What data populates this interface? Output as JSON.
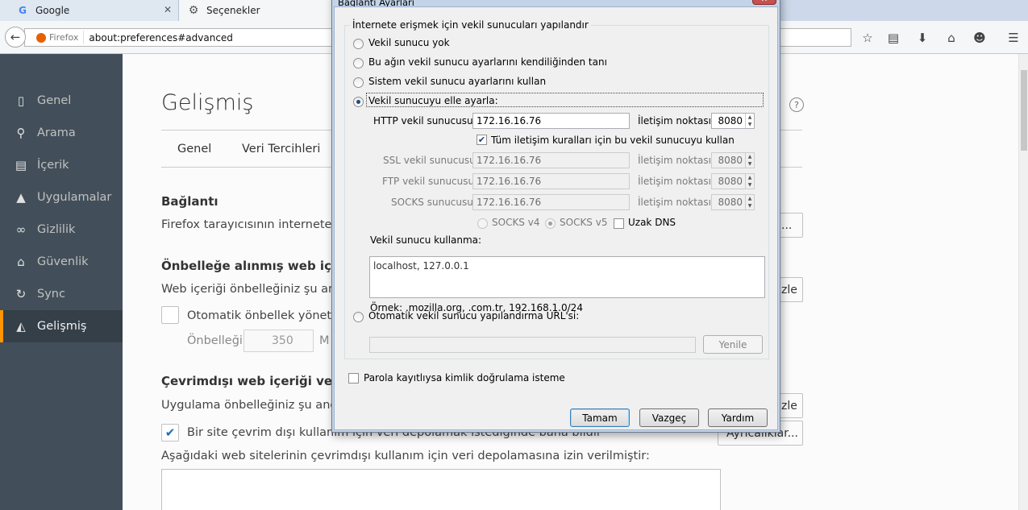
{
  "browser": {
    "tabs": [
      {
        "label": "Google",
        "icon": "google-icon",
        "active": false
      },
      {
        "label": "Seçenekler",
        "icon": "gear-icon",
        "active": true
      }
    ],
    "identity_label": "Firefox",
    "url": "about:preferences#advanced"
  },
  "sidebar": {
    "items": [
      {
        "label": "Genel",
        "icon": "general-icon",
        "selected": false
      },
      {
        "label": "Arama",
        "icon": "search-icon",
        "selected": false
      },
      {
        "label": "İçerik",
        "icon": "content-icon",
        "selected": false
      },
      {
        "label": "Uygulamalar",
        "icon": "rocket-icon",
        "selected": false
      },
      {
        "label": "Gizlilik",
        "icon": "mask-icon",
        "selected": false
      },
      {
        "label": "Güvenlik",
        "icon": "lock-icon",
        "selected": false
      },
      {
        "label": "Sync",
        "icon": "sync-icon",
        "selected": false
      },
      {
        "label": "Gelişmiş",
        "icon": "wizard-hat-icon",
        "selected": true
      }
    ]
  },
  "main": {
    "title": "Gelişmiş",
    "subtabs": [
      "Genel",
      "Veri Tercihleri"
    ],
    "connection": {
      "heading": "Bağlantı",
      "desc": "Firefox tarayıcısının internete na",
      "button_label": "..."
    },
    "cache": {
      "heading": "Önbelleğe alınmış web içeri",
      "desc": "Web içeriği önbelleğiniz şu anda",
      "clear_label": "zle",
      "auto_label": "Otomatik önbellek yönetim",
      "limit_label": "Önbelleği",
      "limit_value": "350",
      "unit": "M"
    },
    "offline": {
      "heading": "Çevrimdışı web içeriği ve ku",
      "desc": "Uygulama önbelleğiniz şu anda",
      "clear_label": "zle",
      "notify_label": "Bir site çevrim dışı kullanım için veri depolamak istediğinde bana bildir",
      "notify_checked": true,
      "exceptions_label": "Ayrıcalıklar...",
      "allowed_label": "Aşağıdaki web sitelerinin çevrimdışı kullanım için veri depolamasına izin verilmiştir:"
    }
  },
  "dialog": {
    "title": "Bağlantı Ayarları",
    "group_label": "İnternete erişmek için vekil sunucuları yapılandır",
    "options": {
      "no_proxy": "Vekil sunucu yok",
      "auto_detect": "Bu ağın vekil sunucu ayarlarını kendiliğinden tanı",
      "system": "Sistem vekil sunucu ayarlarını kullan",
      "manual": "Vekil sunucuyu elle ayarla:",
      "pac": "Otomatik vekil sunucu yapılandırma URL'si:"
    },
    "selected_option": "manual",
    "http_label": "HTTP vekil sunucusu:",
    "http_value": "172.16.16.76",
    "http_port_label": "İletişim noktası:",
    "http_port": "8080",
    "share_label": "Tüm iletişim kuralları için bu vekil sunucuyu kullan",
    "share_checked": true,
    "ssl_label": "SSL vekil sunucusu:",
    "ssl_value": "172.16.16.76",
    "ssl_port_label": "İletişim noktası:",
    "ssl_port": "8080",
    "ftp_label": "FTP vekil sunucusu:",
    "ftp_value": "172.16.16.76",
    "ftp_port_label": "İletişim noktası:",
    "ftp_port": "8080",
    "socks_label": "SOCKS sunucusu:",
    "socks_value": "172.16.16.76",
    "socks_port_label": "İletişim noktası:",
    "socks_port": "8080",
    "socks_v4": "SOCKS v4",
    "socks_v5": "SOCKS v5",
    "remote_dns": "Uzak DNS",
    "no_proxy_for_label": "Vekil sunucu kullanma:",
    "no_proxy_for_value": "localhost, 127.0.0.1",
    "example": "Örnek: .mozilla.org, .com.tr, 192.168.1.0/24",
    "reload_label": "Yenile",
    "no_auth_prompt_label": "Parola kayıtlıysa kimlik doğrulama isteme",
    "ok_label": "Tamam",
    "cancel_label": "Vazgeç",
    "help_label": "Yardım"
  }
}
